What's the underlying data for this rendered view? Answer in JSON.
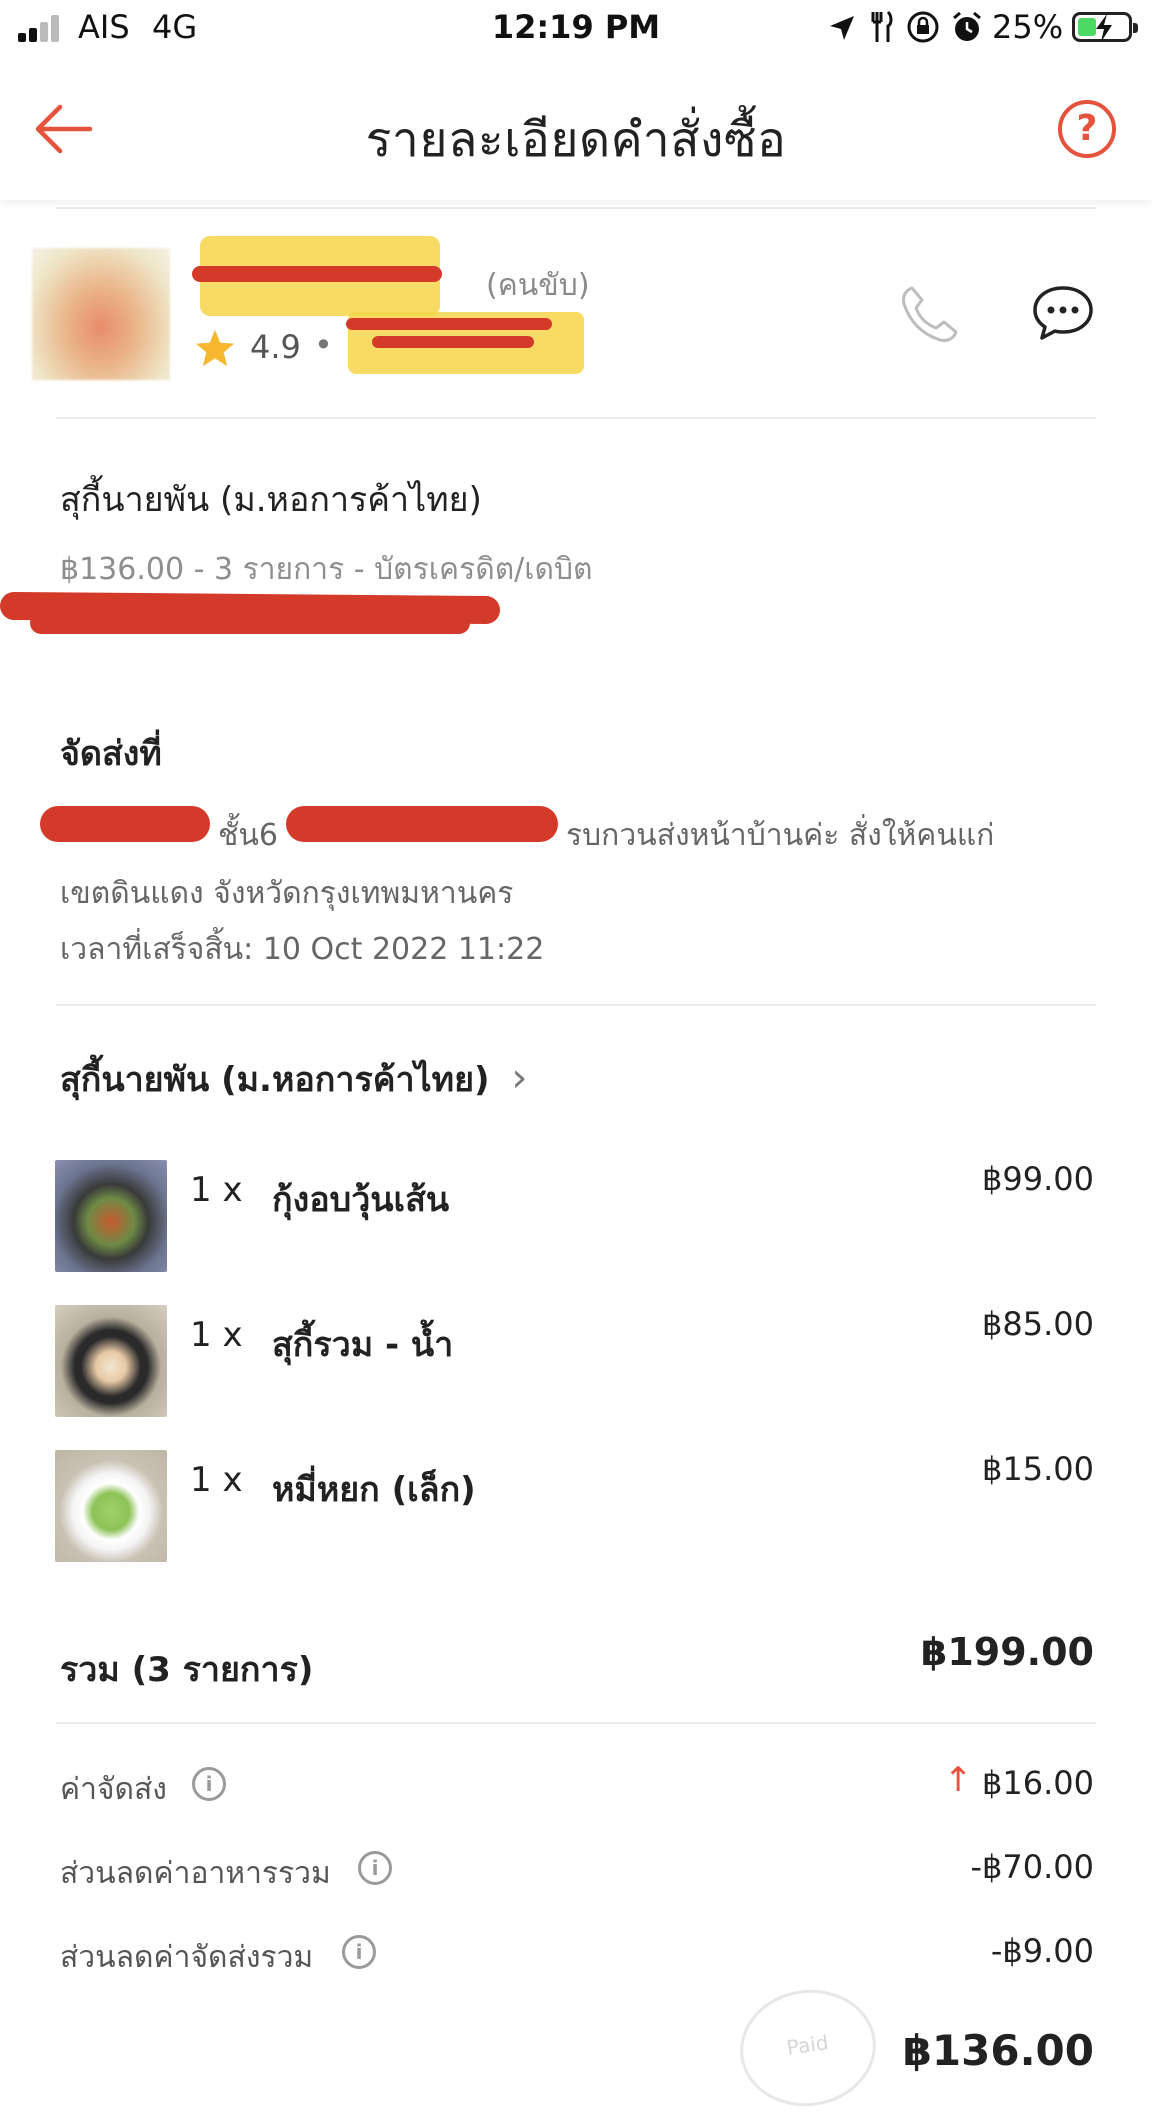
{
  "status_bar": {
    "carrier": "AIS",
    "network": "4G",
    "time": "12:19 PM",
    "battery": "25%"
  },
  "header": {
    "title": "รายละเอียดคำสั่งซื้อ",
    "help": "?"
  },
  "driver": {
    "role": "(คนขับ)",
    "rating": "4.9",
    "separator": "•"
  },
  "order": {
    "restaurant": "สุกี้นายพัน (ม.หอการค้าไทย)",
    "summary": "฿136.00 - 3 รายการ  - บัตรเครดิต/เดบิต"
  },
  "delivery": {
    "heading": "จัดส่งที่",
    "floor": "ชั้น6",
    "note": "รบกวนส่งหน้าบ้านค่ะ สั่งให้คนแก่",
    "area": "เขตดินแดง จังหวัดกรุงเทพมหานคร",
    "completed": "เวลาที่เสร็จสิ้น: 10 Oct 2022 11:22"
  },
  "restaurant_link": {
    "name": "สุกี้นายพัน (ม.หอการค้าไทย)",
    "chevron": "›"
  },
  "items": [
    {
      "qty": "1 x",
      "name": "กุ้งอบวุ้นเส้น",
      "price": "฿99.00"
    },
    {
      "qty": "1 x",
      "name": "สุกี้รวม - น้ำ",
      "price": "฿85.00"
    },
    {
      "qty": "1 x",
      "name": "หมี่หยก (เล็ก)",
      "price": "฿15.00"
    }
  ],
  "subtotal": {
    "label": "รวม (3 รายการ)",
    "value": "฿199.00"
  },
  "fees": [
    {
      "label": "ค่าจัดส่ง",
      "value": "฿16.00",
      "arrow": "↑"
    },
    {
      "label": "ส่วนลดค่าอาหารรวม",
      "value": "-฿70.00"
    },
    {
      "label": "ส่วนลดค่าจัดส่งรวม",
      "value": "-฿9.00"
    }
  ],
  "total": {
    "value": "฿136.00",
    "stamp": "Paid"
  },
  "colors": {
    "accent": "#e5533d",
    "star": "#f7b731"
  }
}
